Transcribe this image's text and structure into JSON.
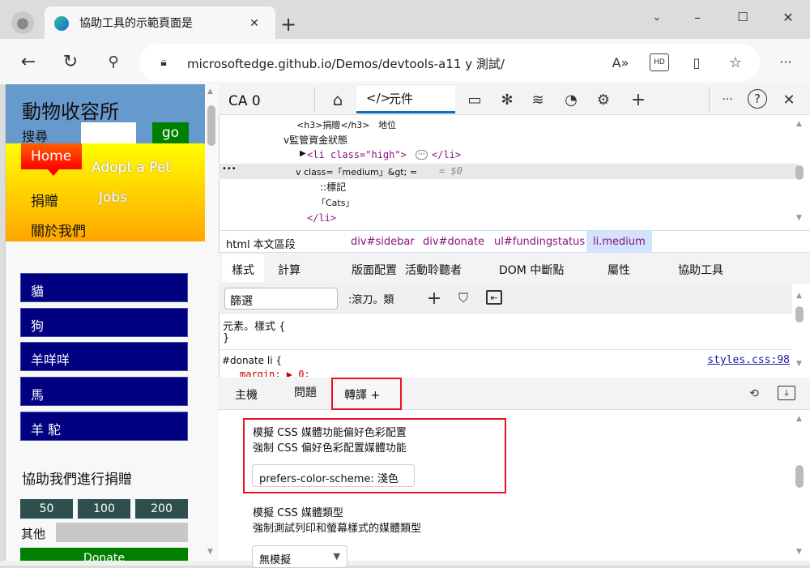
{
  "browser": {
    "tab_title": "協助工具的示範頁面是",
    "url": "microsoftedge.github.io/Demos/devtools-a11 y 測試/",
    "icons": [
      "profile-icon",
      "edge-logo-icon",
      "close-icon",
      "new-tab-icon",
      "tab-list-icon",
      "minimize-icon",
      "maximize-icon",
      "close-window-icon",
      "back-icon",
      "refresh-icon",
      "search-icon",
      "lock-icon",
      "read-aloud-icon",
      "hd-icon",
      "immersive-reader-icon",
      "favorite-icon",
      "more-icon"
    ]
  },
  "page": {
    "title": "動物收容所",
    "search_label": "搜尋",
    "go": "go",
    "nav": [
      "Home",
      "Adopt a Pet",
      "捐贈",
      "Jobs",
      "關於我們"
    ],
    "animals": [
      "貓",
      "狗",
      "羊咩咩",
      "馬",
      "羊 駝"
    ],
    "donate_heading": "協助我們進行捐贈",
    "amounts": [
      "50",
      "100",
      "200"
    ],
    "other_label": "其他",
    "donate_button": "Donate",
    "colors": {
      "header": "#6699cc",
      "nav_item": "#000080",
      "amount": "#2f4f4f",
      "go": "#008000"
    }
  },
  "devtools": {
    "ca": "CA 0",
    "elements_tab": "元件",
    "dom": {
      "line1": "<h3>捐贈</h3>",
      "line1b": "地位",
      "line2": "v監管資金狀態",
      "line3_tag": "<li class=\"high\">",
      "line3_end": "</li>",
      "line4": "v class=「medium」&gt; =",
      "line4_ref": "= $0",
      "line5": "::標記",
      "line6": "「Cats」",
      "line7": "</li>"
    },
    "breadcrumbs": [
      "html 本文區段",
      "div#sidebar",
      "div#donate",
      "ul#fundingstatus",
      "li.medium"
    ],
    "style_tabs": [
      "樣式",
      "計算",
      "版面配置",
      "活動聆聽者",
      "DOM 中斷點",
      "屬性",
      "協助工具"
    ],
    "filter_placeholder": "篩選",
    "pseudo": ":滾刀。類",
    "rule1_open": "元素。樣式 {",
    "rule1_close": "}",
    "rule2_selector": "#donate li {",
    "rule2_source": "styles.css:98",
    "rule2_prop": "margin: ▶ 0;",
    "drawer_tabs": [
      "主機",
      "問題",
      "轉譯 +"
    ],
    "rendering": {
      "s1_title": "模擬 CSS 媒體功能偏好色彩配置",
      "s1_desc": "強制 CSS 偏好色彩配置媒體功能",
      "s1_value": "prefers-color-scheme: 淺色",
      "s2_title": "模擬 CSS 媒體類型",
      "s2_desc": "強制測試列印和螢幕樣式的媒體類型",
      "s2_value": "無模擬"
    }
  }
}
